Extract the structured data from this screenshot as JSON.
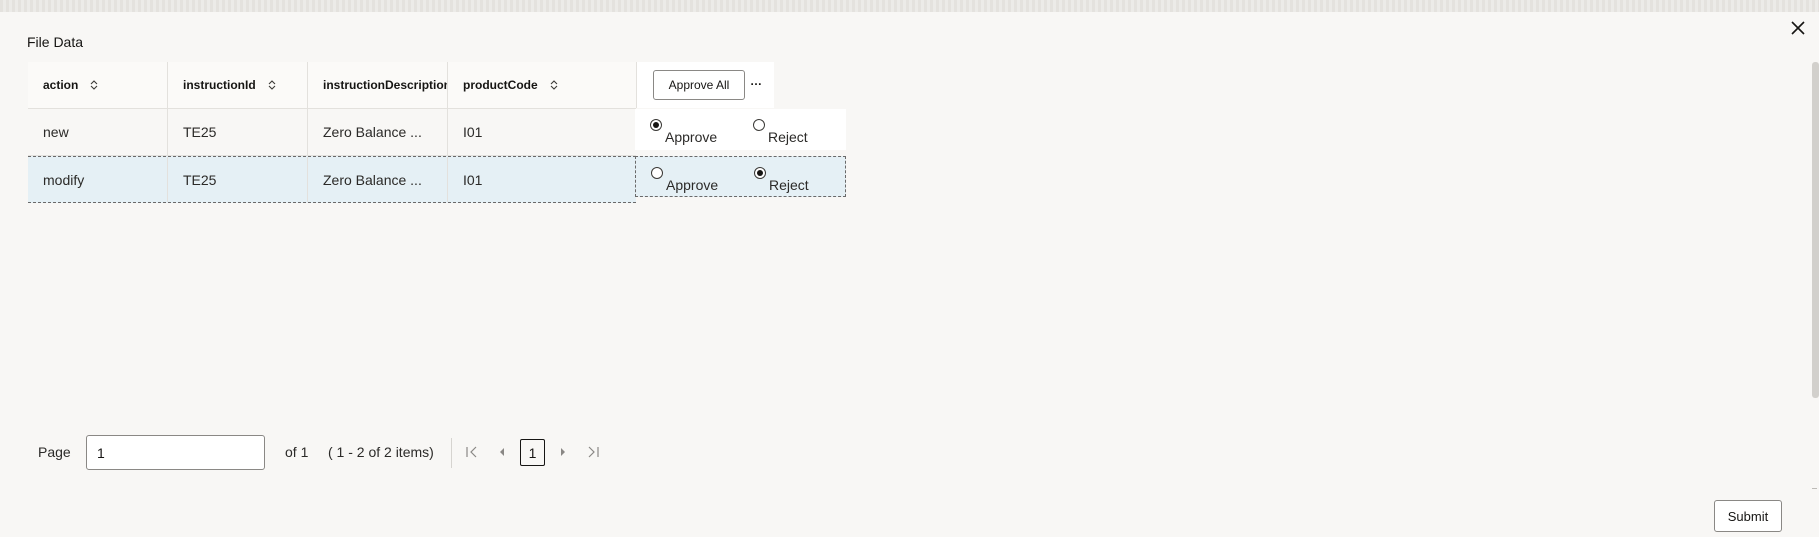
{
  "dialog": {
    "title": "File Data",
    "close_icon": "close-icon"
  },
  "table": {
    "columns": [
      {
        "label": "action",
        "sortable": true
      },
      {
        "label": "instructionId",
        "sortable": true
      },
      {
        "label": "instructionDescription",
        "sortable": false
      },
      {
        "label": "productCode",
        "sortable": true
      }
    ],
    "approve_all_label": "Approve All",
    "more_icon": "…",
    "rows": [
      {
        "action": "new",
        "instructionId": "TE25",
        "instructionDescription": "Zero Balance ...",
        "productCode": "I01",
        "approve_label": "Approve",
        "reject_label": "Reject",
        "decision": "Approve",
        "selected": false
      },
      {
        "action": "modify",
        "instructionId": "TE25",
        "instructionDescription": "Zero Balance ...",
        "productCode": "I01",
        "approve_label": "Approve",
        "reject_label": "Reject",
        "decision": "Reject",
        "selected": true
      }
    ]
  },
  "pagination": {
    "page_label": "Page",
    "page_value": "1",
    "of_text": "of 1",
    "items_text": "( 1 - 2 of 2 items)",
    "current_page": "1"
  },
  "footer": {
    "submit_label": "Submit"
  },
  "colors": {
    "background": "#f8f7f5",
    "selected_row": "#e5f0f5"
  }
}
